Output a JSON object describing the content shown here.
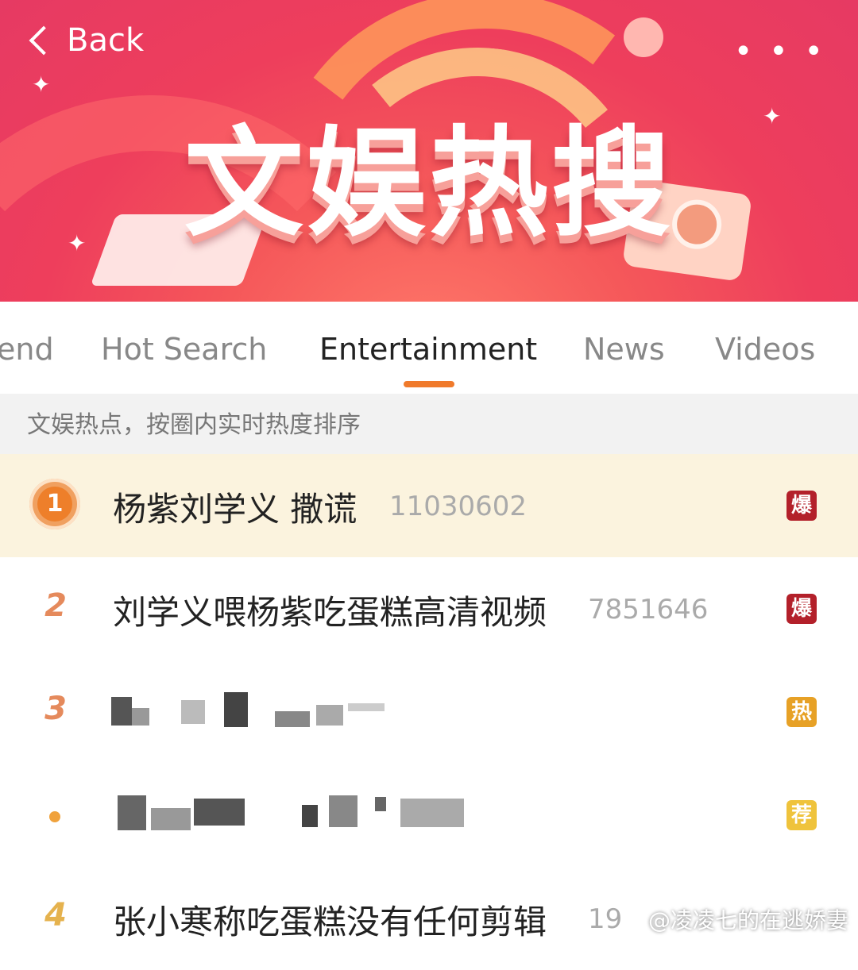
{
  "header": {
    "back_label": "Back",
    "more_label": "• • •",
    "banner_title": "文娱热搜"
  },
  "tabs": [
    {
      "label": "end"
    },
    {
      "label": "Hot Search"
    },
    {
      "label": "Entertainment",
      "active": true
    },
    {
      "label": "News"
    },
    {
      "label": "Videos"
    }
  ],
  "subheader": "文娱热点，按圈内实时热度排序",
  "rows": [
    {
      "rank": "1",
      "title": "杨紫刘学义 撒谎",
      "count": "11030602",
      "badge": "爆"
    },
    {
      "rank": "2",
      "title": "刘学义喂杨紫吃蛋糕高清视频",
      "count": "7851646",
      "badge": "爆"
    },
    {
      "rank": "3",
      "title": "",
      "count": "",
      "badge": "热"
    },
    {
      "rank": "•",
      "title": "",
      "count": "",
      "badge": "荐"
    },
    {
      "rank": "4",
      "title": "张小寒称吃蛋糕没有任何剪辑",
      "count": "19",
      "badge": ""
    }
  ],
  "watermark": "@凌凌七的在逃娇妻",
  "colors": {
    "accent": "#f07a2b",
    "banner": "#ee3e5c",
    "badge_bao": "#b3202a",
    "badge_re": "#e7a126",
    "badge_jian": "#efc33c"
  }
}
